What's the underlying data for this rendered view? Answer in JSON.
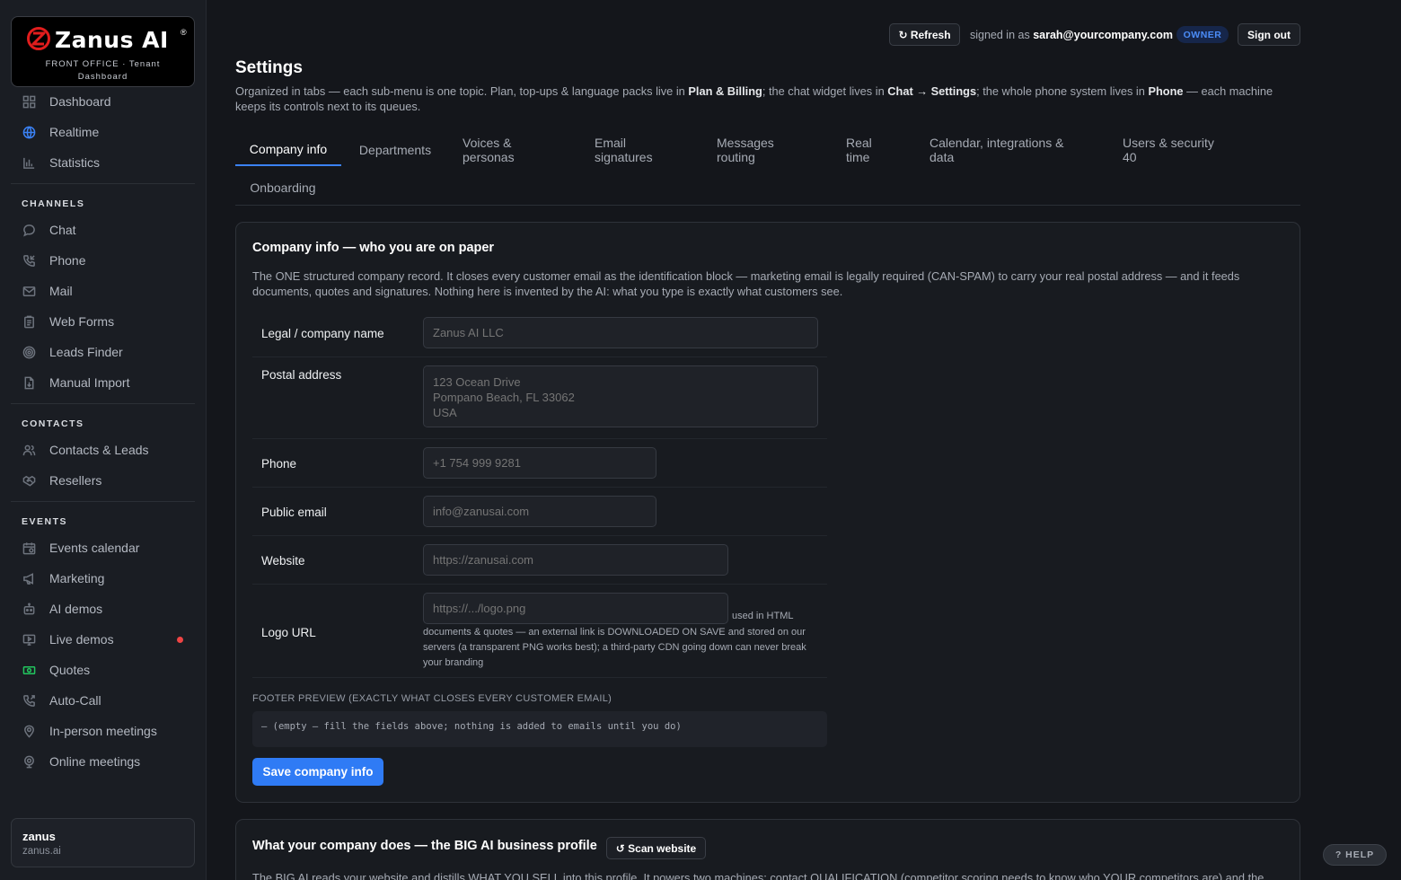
{
  "brand": {
    "name": "Zanus AI",
    "registered": "®",
    "subtitle_line1": "FRONT OFFICE · Tenant",
    "subtitle_line2": "Dashboard"
  },
  "sidebar": {
    "top_items": [
      {
        "label": "Dashboard",
        "icon": "dashboard-icon"
      },
      {
        "label": "Realtime",
        "icon": "globe-icon"
      },
      {
        "label": "Statistics",
        "icon": "bar-chart-icon"
      }
    ],
    "sections": {
      "channels": "CHANNELS",
      "contacts": "CONTACTS",
      "events": "EVENTS"
    },
    "channels": [
      {
        "label": "Chat",
        "icon": "chat-bubble-icon"
      },
      {
        "label": "Phone",
        "icon": "phone-icon"
      },
      {
        "label": "Mail",
        "icon": "mail-icon"
      },
      {
        "label": "Web Forms",
        "icon": "clipboard-icon"
      },
      {
        "label": "Leads Finder",
        "icon": "target-icon"
      },
      {
        "label": "Manual Import",
        "icon": "file-import-icon"
      }
    ],
    "contacts": [
      {
        "label": "Contacts & Leads",
        "icon": "users-icon"
      },
      {
        "label": "Resellers",
        "icon": "handshake-icon"
      }
    ],
    "events": [
      {
        "label": "Events calendar",
        "icon": "calendar-icon"
      },
      {
        "label": "Marketing",
        "icon": "megaphone-icon"
      },
      {
        "label": "AI demos",
        "icon": "robot-icon"
      },
      {
        "label": "Live demos",
        "icon": "monitor-play-icon"
      },
      {
        "label": "Quotes",
        "icon": "money-icon"
      },
      {
        "label": "Auto-Call",
        "icon": "phone-outgoing-icon"
      },
      {
        "label": "In-person meetings",
        "icon": "map-pin-icon"
      },
      {
        "label": "Online meetings",
        "icon": "webcam-icon"
      }
    ],
    "user": {
      "name": "zanus",
      "domain": "zanus.ai"
    }
  },
  "topbar": {
    "refresh_label": "↻ Refresh",
    "signed_in_prefix": "signed in as",
    "email": "sarah@yourcompany.com",
    "role_badge": "OWNER",
    "sign_out_label": "Sign out"
  },
  "page": {
    "title": "Settings",
    "desc_1": "Organized in tabs — each sub-menu is one topic. Plan, top-ups & language packs live in ",
    "desc_b1": "Plan & Billing",
    "desc_2": "; the chat widget lives in ",
    "desc_b2": "Chat → Settings",
    "desc_3": "; the whole phone system lives in ",
    "desc_b3": "Phone",
    "desc_4": " — each machine keeps its controls next to its queues."
  },
  "tabs": [
    "Company info",
    "Departments",
    "Voices & personas",
    "Email signatures",
    "Messages routing",
    "Real time",
    "Calendar, integrations & data",
    "Users & security 40",
    "Onboarding"
  ],
  "company_card": {
    "title": "Company info — who you are on paper",
    "desc": "The ONE structured company record. It closes every customer email as the identification block — marketing email is legally required (CAN-SPAM) to carry your real postal address — and it feeds documents, quotes and signatures. Nothing here is invented by the AI: what you type is exactly what customers see.",
    "fields": {
      "legal_name_label": "Legal / company name",
      "legal_name_placeholder": "Zanus AI LLC",
      "address_label": "Postal address",
      "address_placeholder": "123 Ocean Drive\nPompano Beach, FL 33062\nUSA",
      "phone_label": "Phone",
      "phone_placeholder": "+1 754 999 9281",
      "email_label": "Public email",
      "email_placeholder": "info@zanusai.com",
      "website_label": "Website",
      "website_placeholder": "https://zanusai.com",
      "logo_label": "Logo URL",
      "logo_placeholder": "https://.../logo.png",
      "logo_help_inline": "used in HTML",
      "logo_help": "documents & quotes — an external link is DOWNLOADED ON SAVE and stored on our servers (a transparent PNG works best); a third-party CDN going down can never break your branding"
    },
    "footer_preview_label": "FOOTER PREVIEW (EXACTLY WHAT CLOSES EVERY CUSTOMER EMAIL)",
    "footer_preview_text": "— (empty — fill the fields above; nothing is added to emails until you do)",
    "save_label": "Save company info"
  },
  "profile_card": {
    "title": "What your company does — the BIG AI business profile",
    "scan_label": "↺ Scan website",
    "desc": "The BIG AI reads your website and distills WHAT YOU SELL into this profile. It powers two machines: contact QUALIFICATION (competitor scoring needs to know who YOUR competitors are) and the"
  },
  "help_label": "? HELP",
  "colors": {
    "accent": "#2f7bf5",
    "live_dot": "#ef4444",
    "brand_red": "#e11d1d"
  }
}
